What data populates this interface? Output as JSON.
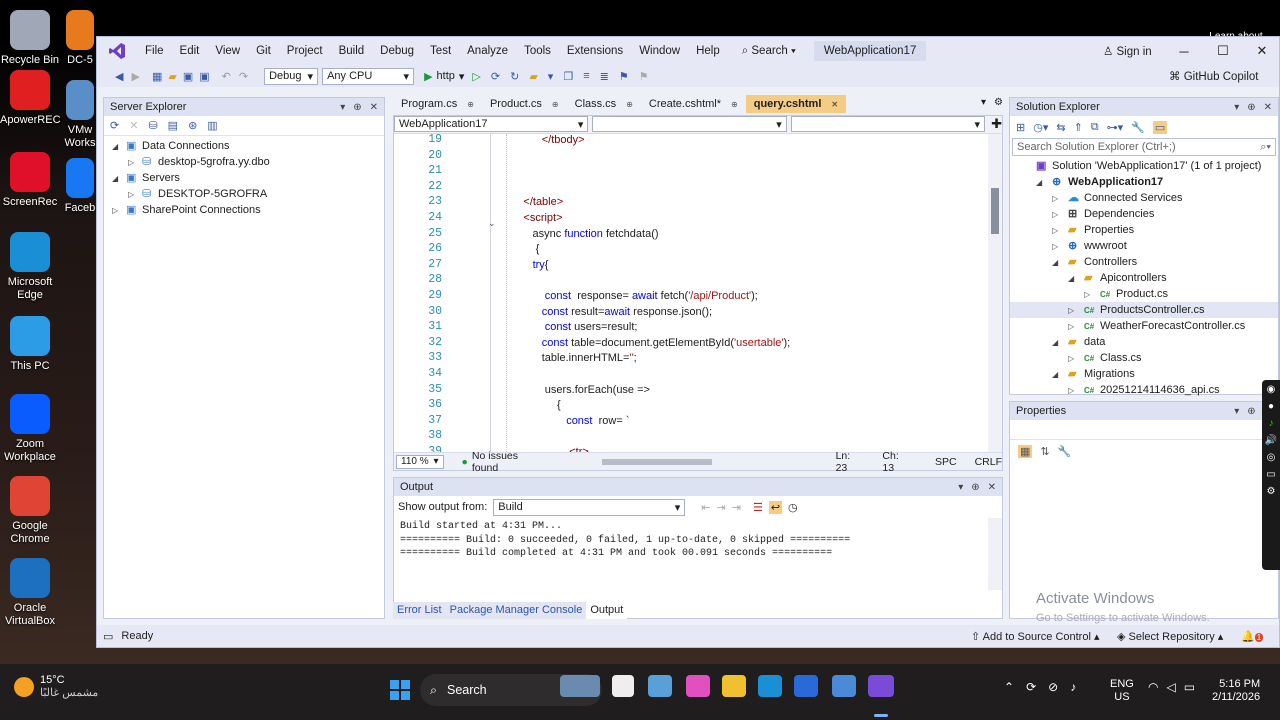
{
  "desktop": {
    "icons": [
      {
        "label": "Recycle Bin",
        "color": "#a0a8b8"
      },
      {
        "label": "ApowerREC",
        "color": "#e02020"
      },
      {
        "label": "ScreenRec",
        "color": "#e0102a"
      },
      {
        "label": "Microsoft Edge",
        "color": "#1a8fd6"
      },
      {
        "label": "This PC",
        "color": "#2d9ce6"
      },
      {
        "label": "Zoom Workplace",
        "color": "#0b5cff"
      },
      {
        "label": "Google Chrome",
        "color": "#e04434"
      },
      {
        "label": "Oracle VirtualBox",
        "color": "#1d6fbf"
      }
    ],
    "icons_col2": [
      {
        "label": "DC-5",
        "color": "#e87a1e"
      },
      {
        "label": "VMw Works",
        "color": "#5a8ec8"
      },
      {
        "label": "Faceb",
        "color": "#1877f2"
      }
    ],
    "top_right": "Learn about"
  },
  "menubar": {
    "items": [
      "File",
      "Edit",
      "View",
      "Git",
      "Project",
      "Build",
      "Debug",
      "Test",
      "Analyze",
      "Tools",
      "Extensions",
      "Window",
      "Help"
    ],
    "search": "Search",
    "solution": "WebApplication17",
    "signin": "Sign in",
    "copilot": "GitHub Copilot"
  },
  "toolbar": {
    "config": "Debug",
    "platform": "Any CPU",
    "run": "http"
  },
  "server_explorer": {
    "title": "Server Explorer",
    "items": [
      {
        "label": "Data Connections",
        "indent": 0,
        "exp": "◢"
      },
      {
        "label": "desktop-5grofra.yy.dbo",
        "indent": 1,
        "exp": "▷"
      },
      {
        "label": "Servers",
        "indent": 0,
        "exp": "◢"
      },
      {
        "label": "DESKTOP-5GROFRA",
        "indent": 1,
        "exp": "▷"
      },
      {
        "label": "SharePoint Connections",
        "indent": 0,
        "exp": "▷"
      }
    ]
  },
  "editor": {
    "tabs": [
      {
        "label": "Program.cs",
        "active": false,
        "close": "⊕"
      },
      {
        "label": "Product.cs",
        "active": false,
        "close": "⊕"
      },
      {
        "label": "Class.cs",
        "active": false,
        "close": "⊕"
      },
      {
        "label": "Create.cshtml*",
        "active": false,
        "close": "⊕"
      },
      {
        "label": "query.cshtml",
        "active": true,
        "close": "✕"
      }
    ],
    "project_combo": "WebApplication17",
    "lines": [
      {
        "n": "19",
        "segs": [
          [
            "pl",
            "             "
          ],
          [
            "tg",
            "</tbody>"
          ]
        ]
      },
      {
        "n": "20",
        "segs": []
      },
      {
        "n": "21",
        "segs": []
      },
      {
        "n": "22",
        "segs": []
      },
      {
        "n": "23",
        "segs": [
          [
            "pl",
            "       "
          ],
          [
            "tg",
            "</table>"
          ]
        ]
      },
      {
        "n": "24",
        "segs": [
          [
            "pl",
            "       "
          ],
          [
            "tg",
            "<script>"
          ]
        ]
      },
      {
        "n": "25",
        "segs": [
          [
            "pl",
            "          async "
          ],
          [
            "kw",
            "function"
          ],
          [
            "pl",
            " fetchdata()"
          ]
        ]
      },
      {
        "n": "26",
        "segs": [
          [
            "pl",
            "           {"
          ]
        ]
      },
      {
        "n": "27",
        "segs": [
          [
            "pl",
            "          "
          ],
          [
            "kw",
            "try"
          ],
          [
            "pl",
            "{"
          ]
        ]
      },
      {
        "n": "28",
        "segs": []
      },
      {
        "n": "29",
        "segs": [
          [
            "pl",
            "              "
          ],
          [
            "kw",
            "const"
          ],
          [
            "pl",
            "  response= "
          ],
          [
            "kw",
            "await"
          ],
          [
            "pl",
            " fetch("
          ],
          [
            "st",
            "'/api/Product'"
          ],
          [
            "pl",
            ");"
          ]
        ]
      },
      {
        "n": "30",
        "segs": [
          [
            "pl",
            "             "
          ],
          [
            "kw",
            "const"
          ],
          [
            "pl",
            " result="
          ],
          [
            "kw",
            "await"
          ],
          [
            "pl",
            " response.json();"
          ]
        ]
      },
      {
        "n": "31",
        "segs": [
          [
            "pl",
            "              "
          ],
          [
            "kw",
            "const"
          ],
          [
            "pl",
            " users=result;"
          ]
        ]
      },
      {
        "n": "32",
        "segs": [
          [
            "pl",
            "             "
          ],
          [
            "kw",
            "const"
          ],
          [
            "pl",
            " table=document.getElementById("
          ],
          [
            "st",
            "'usertable'"
          ],
          [
            "pl",
            ");"
          ]
        ]
      },
      {
        "n": "33",
        "segs": [
          [
            "pl",
            "             table.innerHTML="
          ],
          [
            "st",
            "''"
          ],
          [
            "pl",
            ";"
          ]
        ]
      },
      {
        "n": "34",
        "segs": []
      },
      {
        "n": "35",
        "segs": [
          [
            "pl",
            "              users.forEach(use =>"
          ]
        ]
      },
      {
        "n": "36",
        "segs": [
          [
            "pl",
            "                  {"
          ]
        ]
      },
      {
        "n": "37",
        "segs": [
          [
            "pl",
            "                     "
          ],
          [
            "kw",
            "const"
          ],
          [
            "pl",
            "  row= `"
          ]
        ]
      },
      {
        "n": "38",
        "segs": []
      },
      {
        "n": "39",
        "segs": [
          [
            "pl",
            "                      "
          ],
          [
            "tg",
            "<tr>"
          ]
        ]
      }
    ],
    "zoom": "110 %",
    "issues": "No issues found",
    "ln": "Ln: 23",
    "ch": "Ch: 13",
    "spc": "SPC",
    "crlf": "CRLF"
  },
  "output": {
    "title": "Output",
    "show_from": "Show output from:",
    "source": "Build",
    "lines": [
      "Build started at 4:31 PM...",
      "========== Build: 0 succeeded, 0 failed, 1 up-to-date, 0 skipped ==========",
      "========== Build completed at 4:31 PM and took 00.091 seconds =========="
    ],
    "tabs": [
      "Error List",
      "Package Manager Console",
      "Output"
    ]
  },
  "solution_explorer": {
    "title": "Solution Explorer",
    "search_placeholder": "Search Solution Explorer (Ctrl+;)",
    "items": [
      {
        "label": "Solution 'WebApplication17' (1 of 1 project)",
        "indent": 0,
        "exp": "",
        "icon": "sln",
        "bold": false
      },
      {
        "label": "WebApplication17",
        "indent": 1,
        "exp": "◢",
        "icon": "proj",
        "bold": true
      },
      {
        "label": "Connected Services",
        "indent": 2,
        "exp": "▷",
        "icon": "cloud",
        "bold": false
      },
      {
        "label": "Dependencies",
        "indent": 2,
        "exp": "▷",
        "icon": "dep",
        "bold": false
      },
      {
        "label": "Properties",
        "indent": 2,
        "exp": "▷",
        "icon": "folder",
        "bold": false
      },
      {
        "label": "wwwroot",
        "indent": 2,
        "exp": "▷",
        "icon": "globe",
        "bold": false
      },
      {
        "label": "Controllers",
        "indent": 2,
        "exp": "◢",
        "icon": "folder",
        "bold": false
      },
      {
        "label": "Apicontrollers",
        "indent": 3,
        "exp": "◢",
        "icon": "folder",
        "bold": false
      },
      {
        "label": "Product.cs",
        "indent": 4,
        "exp": "▷",
        "icon": "cs",
        "bold": false
      },
      {
        "label": "ProductsController.cs",
        "indent": 3,
        "exp": "▷",
        "icon": "cs",
        "bold": false
      },
      {
        "label": "WeatherForecastController.cs",
        "indent": 3,
        "exp": "▷",
        "icon": "cs",
        "bold": false
      },
      {
        "label": "data",
        "indent": 2,
        "exp": "◢",
        "icon": "folder",
        "bold": false
      },
      {
        "label": "Class.cs",
        "indent": 3,
        "exp": "▷",
        "icon": "cs",
        "bold": false
      },
      {
        "label": "Migrations",
        "indent": 2,
        "exp": "◢",
        "icon": "folder",
        "bold": false
      },
      {
        "label": "20251214114636_api.cs",
        "indent": 3,
        "exp": "▷",
        "icon": "cs",
        "bold": false
      }
    ],
    "selected": 9
  },
  "properties": {
    "title": "Properties"
  },
  "watermark": {
    "line1": "Activate Windows",
    "line2": "Go to Settings to activate Windows."
  },
  "statusbar": {
    "ready": "Ready",
    "source_control": "Add to Source Control",
    "repo": "Select Repository",
    "notif": "1"
  },
  "taskbar": {
    "weather_temp": "15°C",
    "weather_desc": "مشمس غالبًا",
    "search": "Search",
    "lang1": "ENG",
    "lang2": "US",
    "time": "5:16 PM",
    "date": "2/11/2026"
  }
}
